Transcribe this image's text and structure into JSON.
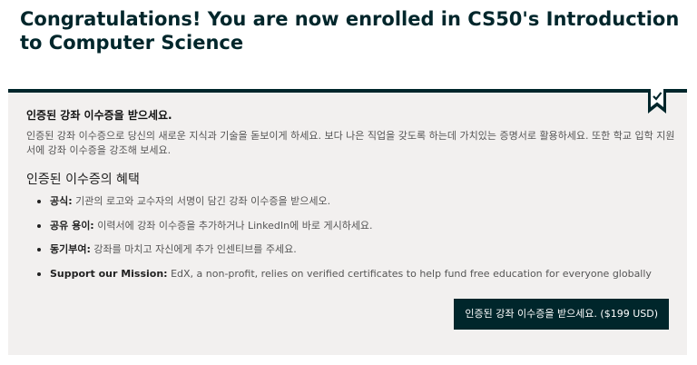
{
  "page": {
    "title": "Congratulations! You are now enrolled in CS50's Introduction to Computer Science"
  },
  "upsell": {
    "title": "인증된 강좌 이수증을 받으세요.",
    "description": "인증된 강좌 이수증으로 당신의 새로운 지식과 기술을 돋보이게 하세요. 보다 나은 직업을 갖도록 하는데 가치있는 증명서로 활용하세요. 또한 학교 입학 지원서에 강좌 이수증을 강조해 보세요.",
    "benefits_heading": "인증된 이수증의 혜택",
    "benefits": [
      {
        "label": "공식:",
        "text": " 기관의 로고와 교수자의 서명이 담긴 강좌 이수증을 받으세오."
      },
      {
        "label": "공유 용이:",
        "text": " 이력서에 강좌 이수증을 추가하거나 LinkedIn에 바로 게시하세요."
      },
      {
        "label": "동기부여:",
        "text": " 강좌를 마치고 자신에게 추가 인센티브를 주세요."
      },
      {
        "label": "Support our Mission:",
        "text": " EdX, a non-profit, relies on verified certificates to help fund free education for everyone globally"
      }
    ],
    "button_label": "인증된 강좌 이수증을 받으세요. ($199 USD)"
  },
  "colors": {
    "dark": "#00262b",
    "panel_background": "#f2f0ef"
  },
  "icons": {
    "badge": "bookmark-check-icon"
  }
}
